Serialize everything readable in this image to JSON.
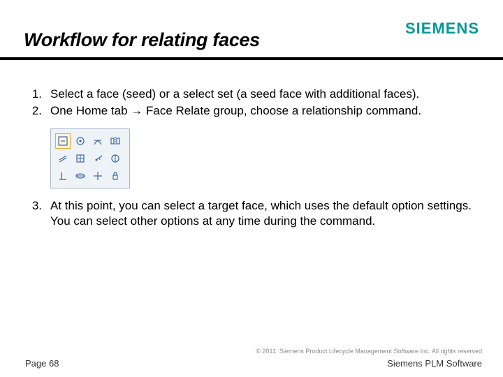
{
  "header": {
    "title": "Workflow for relating faces",
    "brand": "SIEMENS"
  },
  "list": {
    "items": [
      {
        "num": "1.",
        "text": "Select a face (seed) or a select set (a seed face with additional faces)."
      },
      {
        "num": "2.",
        "text": "One Home tab → Face Relate group, choose a relationship command."
      },
      {
        "num": "3.",
        "text": "At this point, you can select a target face, which uses the default option settings. You can select other options at any time during the command."
      }
    ]
  },
  "toolbar": {
    "icons": [
      "parallel-icon",
      "concentric-icon",
      "tangent-icon",
      "symmetric-icon",
      "equal-icon",
      "offset-icon",
      "angle-icon",
      "coplanar-axis-icon",
      "perpendicular-icon",
      "coplanar-icon",
      "horizontal-vertical-icon",
      "rigid-icon"
    ]
  },
  "footer": {
    "copyright": "© 2011. Siemens Product Lifecycle Management Software Inc. All rights reserved",
    "page": "Page 68",
    "product": "Siemens PLM Software"
  }
}
